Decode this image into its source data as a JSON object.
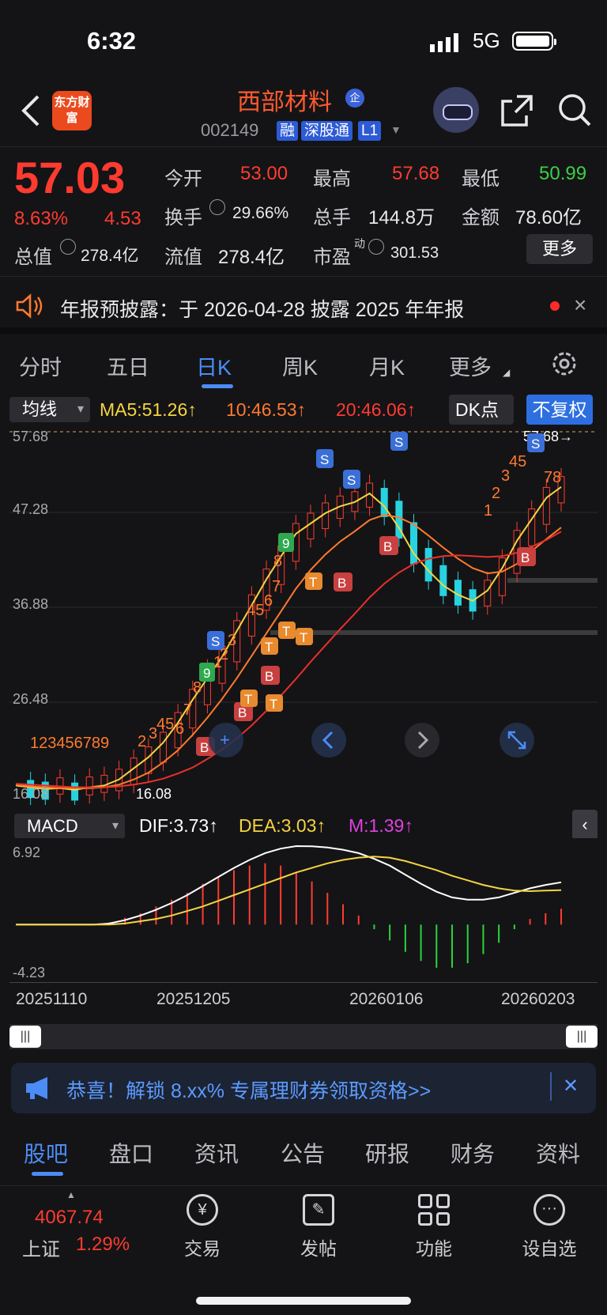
{
  "status": {
    "time": "6:32",
    "network": "5G"
  },
  "header": {
    "logo_text": "东方财富",
    "stock_name": "西部材料",
    "name_badge": "企",
    "stock_code": "002149",
    "tags": [
      "融",
      "深股通",
      "L1"
    ]
  },
  "quote": {
    "price": "57.03",
    "change_pct": "8.63%",
    "change_amt": "4.53",
    "open_label": "今开",
    "open": "53.00",
    "high_label": "最高",
    "high": "57.68",
    "low_label": "最低",
    "low": "50.99",
    "turnover_label": "换手",
    "turnover": "29.66%",
    "volume_label": "总手",
    "volume": "144.8万",
    "amount_label": "金额",
    "amount": "78.60亿",
    "mktcap_label": "总值",
    "mktcap": "278.4亿",
    "float_label": "流值",
    "float": "278.4亿",
    "pe_label": "市盈",
    "pe_sup": "动",
    "pe": "301.53",
    "more_button": "更多"
  },
  "notice": {
    "text": "年报预披露：于 2026-04-28 披露 2025 年年报",
    "close": "×"
  },
  "tabs": [
    {
      "label": "分时"
    },
    {
      "label": "五日"
    },
    {
      "label": "日K",
      "active": true
    },
    {
      "label": "周K"
    },
    {
      "label": "月K"
    },
    {
      "label": "更多"
    }
  ],
  "ma": {
    "selector": "均线",
    "ma5": "MA5:51.26↑",
    "ma10": "10:46.53↑",
    "ma20": "20:46.06↑",
    "dk_button": "DK点",
    "adjust_button": "不复权"
  },
  "kline_axis": {
    "labels": [
      "57.68",
      "47.28",
      "36.88",
      "26.48",
      "16.08"
    ],
    "high_marker": "57.68→",
    "low_marker": "16.08"
  },
  "macd": {
    "selector": "MACD",
    "dif": "DIF:3.73↑",
    "dea": "DEA:3.03↑",
    "m": "M:1.39↑",
    "axis_top": "6.92",
    "axis_bottom": "-4.23"
  },
  "dates": [
    "20251110",
    "20251205",
    "20260106",
    "20260203"
  ],
  "promo": {
    "text": "恭喜！解锁 8.xx% 专属理财券领取资格>>",
    "close": "✕"
  },
  "bottom_tabs": [
    {
      "label": "股吧",
      "active": true
    },
    {
      "label": "盘口"
    },
    {
      "label": "资讯"
    },
    {
      "label": "公告"
    },
    {
      "label": "研报"
    },
    {
      "label": "财务"
    },
    {
      "label": "资料"
    }
  ],
  "index": {
    "value": "4067.74",
    "name": "上证",
    "pct": "1.29%"
  },
  "nav": [
    {
      "label": "交易"
    },
    {
      "label": "发帖"
    },
    {
      "label": "功能"
    },
    {
      "label": "设自选"
    }
  ],
  "chart_data": {
    "type": "line",
    "series": [
      {
        "values": [
          16.5,
          16.3,
          16.1,
          16.2,
          16.0,
          16.3,
          16.5,
          17.2,
          18.5,
          19.8,
          21.5,
          23.8,
          26.5,
          29.0,
          31.5,
          34.5,
          37.5,
          40.5,
          43.2,
          45.8,
          47.0,
          48.2,
          49.0,
          49.5,
          50.5,
          49.0,
          46.5,
          43.5,
          41.5,
          39.8,
          38.7,
          38.0,
          39.2,
          41.8,
          45.0,
          47.5,
          50.0,
          51.26
        ]
      },
      {
        "values": [
          16.6,
          16.4,
          16.3,
          16.2,
          16.2,
          16.2,
          16.3,
          16.6,
          17.2,
          18.0,
          19.2,
          20.6,
          22.4,
          24.4,
          26.6,
          29.0,
          31.6,
          34.2,
          36.8,
          39.4,
          41.6,
          43.4,
          44.9,
          46.1,
          47.4,
          48.0,
          47.7,
          46.9,
          45.6,
          44.2,
          42.9,
          41.8,
          41.2,
          41.4,
          42.3,
          43.8,
          45.2,
          46.53
        ]
      },
      {
        "values": [
          16.7,
          16.6,
          16.5,
          16.4,
          16.3,
          16.3,
          16.3,
          16.4,
          16.6,
          16.9,
          17.3,
          17.9,
          18.6,
          19.6,
          20.7,
          22.0,
          23.5,
          25.2,
          27.0,
          28.9,
          30.9,
          32.8,
          34.7,
          36.5,
          38.4,
          40.0,
          41.3,
          42.3,
          42.9,
          43.2,
          43.3,
          43.2,
          43.1,
          43.2,
          43.6,
          44.3,
          45.1,
          46.06
        ]
      }
    ],
    "ylim": [
      16.08,
      57.68
    ]
  },
  "macd_data": {
    "dif": [
      0,
      0,
      0,
      0,
      0,
      0,
      0.1,
      0.4,
      0.8,
      1.3,
      1.9,
      2.6,
      3.4,
      4.2,
      5.0,
      5.7,
      6.3,
      6.7,
      6.92,
      6.9,
      6.8,
      6.6,
      6.3,
      5.8,
      5.2,
      4.4,
      3.6,
      2.9,
      2.4,
      2.2,
      2.2,
      2.4,
      2.8,
      3.2,
      3.5,
      3.73
    ],
    "dea": [
      0,
      0,
      0,
      0,
      0,
      0,
      0,
      0.1,
      0.3,
      0.5,
      0.8,
      1.2,
      1.6,
      2.1,
      2.6,
      3.1,
      3.6,
      4.1,
      4.6,
      5.0,
      5.4,
      5.7,
      5.9,
      6.0,
      5.9,
      5.6,
      5.2,
      4.8,
      4.3,
      3.9,
      3.5,
      3.2,
      3.0,
      2.95,
      3.0,
      3.03
    ],
    "ylim": [
      -4.23,
      6.92
    ]
  }
}
